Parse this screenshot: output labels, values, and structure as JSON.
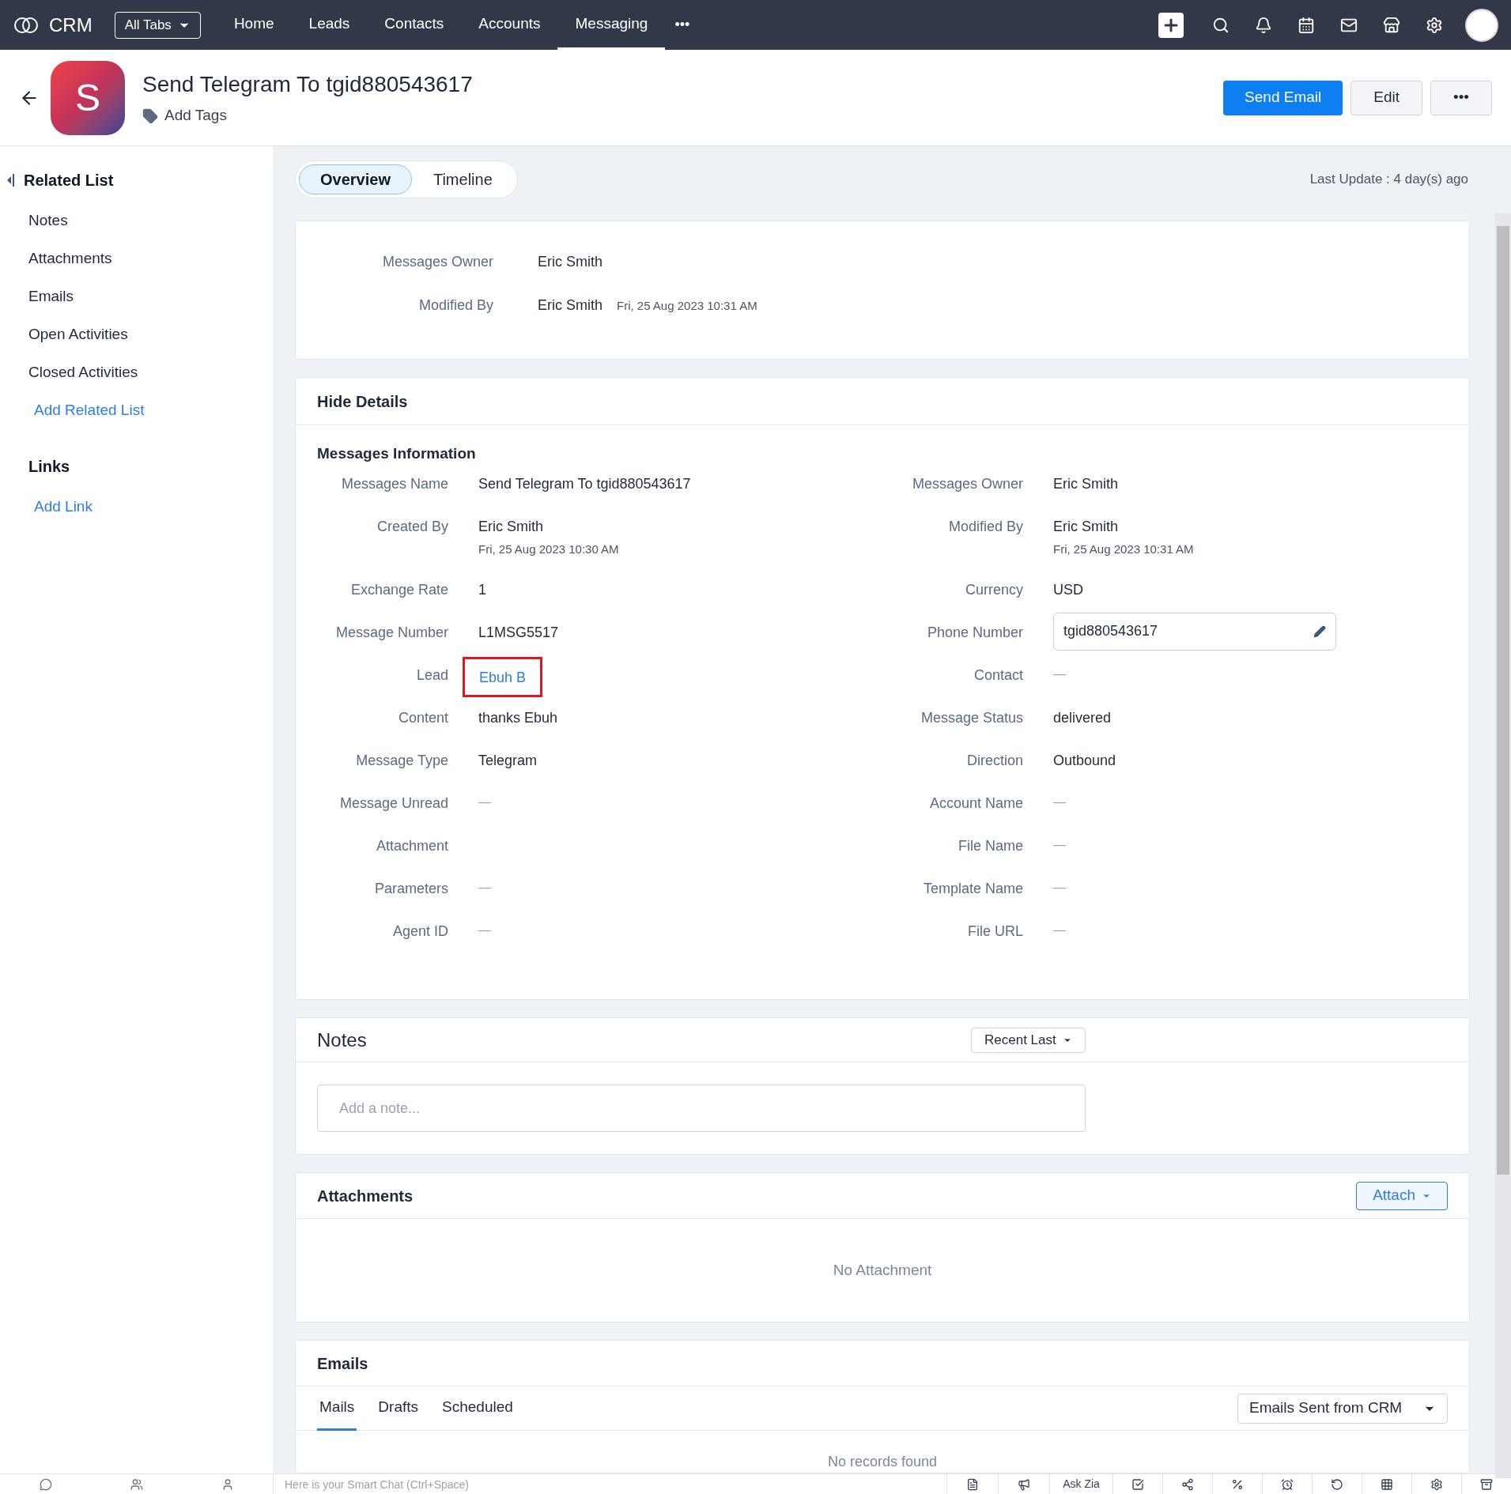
{
  "topbar": {
    "brand": "CRM",
    "all_tabs": "All Tabs",
    "tabs": [
      {
        "label": "Home",
        "selected": false
      },
      {
        "label": "Leads",
        "selected": false
      },
      {
        "label": "Contacts",
        "selected": false
      },
      {
        "label": "Accounts",
        "selected": false
      },
      {
        "label": "Messaging",
        "selected": true
      }
    ],
    "more": "•••"
  },
  "header": {
    "avatar_letter": "S",
    "title": "Send Telegram To tgid880543617",
    "add_tags": "Add Tags",
    "buttons": [
      {
        "label": "Send Email",
        "kind": "primary"
      },
      {
        "label": "Edit",
        "kind": "secondary"
      },
      {
        "label": "•••",
        "kind": "secondary"
      }
    ]
  },
  "sidebar": {
    "related_title": "Related List",
    "items": [
      {
        "label": "Notes",
        "kind": "item"
      },
      {
        "label": "Attachments",
        "kind": "item"
      },
      {
        "label": "Emails",
        "kind": "item"
      },
      {
        "label": "Open Activities",
        "kind": "item"
      },
      {
        "label": "Closed Activities",
        "kind": "item"
      },
      {
        "label": "Add Related List",
        "kind": "link"
      }
    ],
    "links_title": "Links",
    "links": [
      {
        "label": "Add Link",
        "kind": "link"
      }
    ]
  },
  "view_tabs": [
    {
      "label": "Overview",
      "selected": true
    },
    {
      "label": "Timeline",
      "selected": false
    }
  ],
  "last_update": "Last Update : 4 day(s) ago",
  "summary": [
    {
      "label": "Messages Owner",
      "value": "Eric Smith"
    },
    {
      "label": "Modified By",
      "value": "Eric Smith",
      "sub": "Fri, 25 Aug 2023 10:31 AM"
    }
  ],
  "details": {
    "toggle": "Hide Details",
    "section_title": "Messages Information",
    "rows": [
      [
        {
          "label": "Messages Name",
          "value": "Send Telegram To tgid880543617",
          "kind": "text",
          "highlighted": false
        },
        {
          "label": "Messages Owner",
          "value": "Eric Smith",
          "kind": "text",
          "highlighted": false
        }
      ],
      [
        {
          "label": "Created By",
          "value": "Eric Smith",
          "sub": "Fri, 25 Aug 2023 10:30 AM",
          "kind": "text",
          "highlighted": false
        },
        {
          "label": "Modified By",
          "value": "Eric Smith",
          "sub": "Fri, 25 Aug 2023 10:31 AM",
          "kind": "text",
          "highlighted": false
        }
      ],
      [
        {
          "label": "Exchange Rate",
          "value": "1",
          "kind": "text",
          "highlighted": false
        },
        {
          "label": "Currency",
          "value": "USD",
          "kind": "text",
          "highlighted": false
        }
      ],
      [
        {
          "label": "Message Number",
          "value": "L1MSG5517",
          "kind": "text",
          "highlighted": false
        },
        {
          "label": "Phone Number",
          "value": "tgid880543617",
          "kind": "input",
          "highlighted": false
        }
      ],
      [
        {
          "label": "Lead",
          "value": "Ebuh B",
          "kind": "link",
          "highlighted": true
        },
        {
          "label": "Contact",
          "value": "—",
          "kind": "dash",
          "highlighted": false
        }
      ],
      [
        {
          "label": "Content",
          "value": "thanks Ebuh",
          "kind": "text",
          "highlighted": false
        },
        {
          "label": "Message Status",
          "value": "delivered",
          "kind": "text",
          "highlighted": false
        }
      ],
      [
        {
          "label": "Message Type",
          "value": "Telegram",
          "kind": "text",
          "highlighted": false
        },
        {
          "label": "Direction",
          "value": "Outbound",
          "kind": "text",
          "highlighted": false
        }
      ],
      [
        {
          "label": "Message Unread",
          "value": "—",
          "kind": "dash",
          "highlighted": false
        },
        {
          "label": "Account Name",
          "value": "—",
          "kind": "dash",
          "highlighted": false
        }
      ],
      [
        {
          "label": "Attachment",
          "kind": "empty",
          "highlighted": false
        },
        {
          "label": "File Name",
          "value": "—",
          "kind": "dash",
          "highlighted": false
        }
      ],
      [
        {
          "label": "Parameters",
          "value": "—",
          "kind": "dash",
          "highlighted": false
        },
        {
          "label": "Template Name",
          "value": "—",
          "kind": "dash",
          "highlighted": false
        }
      ],
      [
        {
          "label": "Agent ID",
          "value": "—",
          "kind": "dash",
          "highlighted": false
        },
        {
          "label": "File URL",
          "value": "—",
          "kind": "dash",
          "highlighted": false
        }
      ]
    ]
  },
  "notes": {
    "title": "Notes",
    "sort": "Recent Last",
    "placeholder": "Add a note..."
  },
  "attachments": {
    "title": "Attachments",
    "button": "Attach",
    "empty": "No Attachment"
  },
  "emails": {
    "title": "Emails",
    "tabs": [
      {
        "label": "Mails",
        "selected": true
      },
      {
        "label": "Drafts",
        "selected": false
      },
      {
        "label": "Scheduled",
        "selected": false
      }
    ],
    "filter": "Emails Sent from CRM",
    "empty": "No records found"
  },
  "bottom_bar": {
    "chat_placeholder": "Here is your Smart Chat (Ctrl+Space)",
    "ask_zia": "Ask Zia"
  }
}
